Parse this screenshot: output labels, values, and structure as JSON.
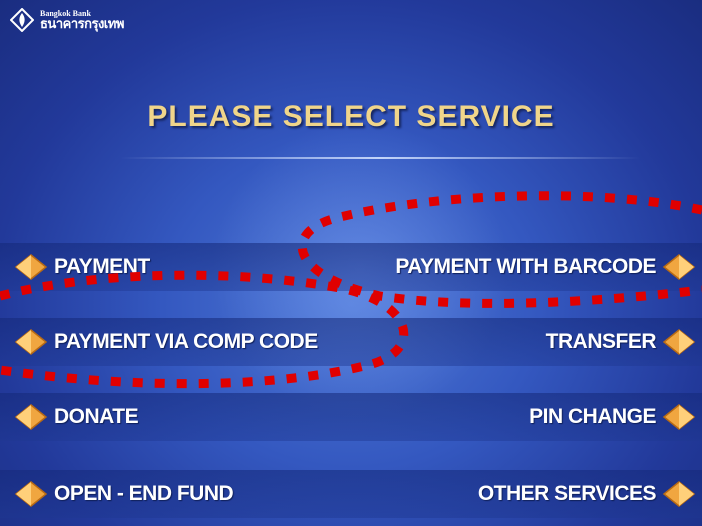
{
  "bank": {
    "name_en": "Bangkok Bank",
    "name_th": "ธนาคารกรุงเทพ"
  },
  "title": "PLEASE SELECT SERVICE",
  "options": {
    "left": [
      {
        "label": "PAYMENT"
      },
      {
        "label": "PAYMENT VIA COMP CODE"
      },
      {
        "label": "DONATE"
      },
      {
        "label": "OPEN - END FUND"
      }
    ],
    "right": [
      {
        "label": "PAYMENT WITH BARCODE"
      },
      {
        "label": "TRANSFER"
      },
      {
        "label": "PIN CHANGE"
      },
      {
        "label": "OTHER SERVICES"
      }
    ]
  },
  "colors": {
    "title": "#f0d58a",
    "arrow": "#f0a640",
    "annotation": "#e00000",
    "background": "#3458c0"
  },
  "icons": {
    "logo": "bangkok-bank-lotus-logo",
    "button_arrow": "orange-diamond-arrow"
  }
}
